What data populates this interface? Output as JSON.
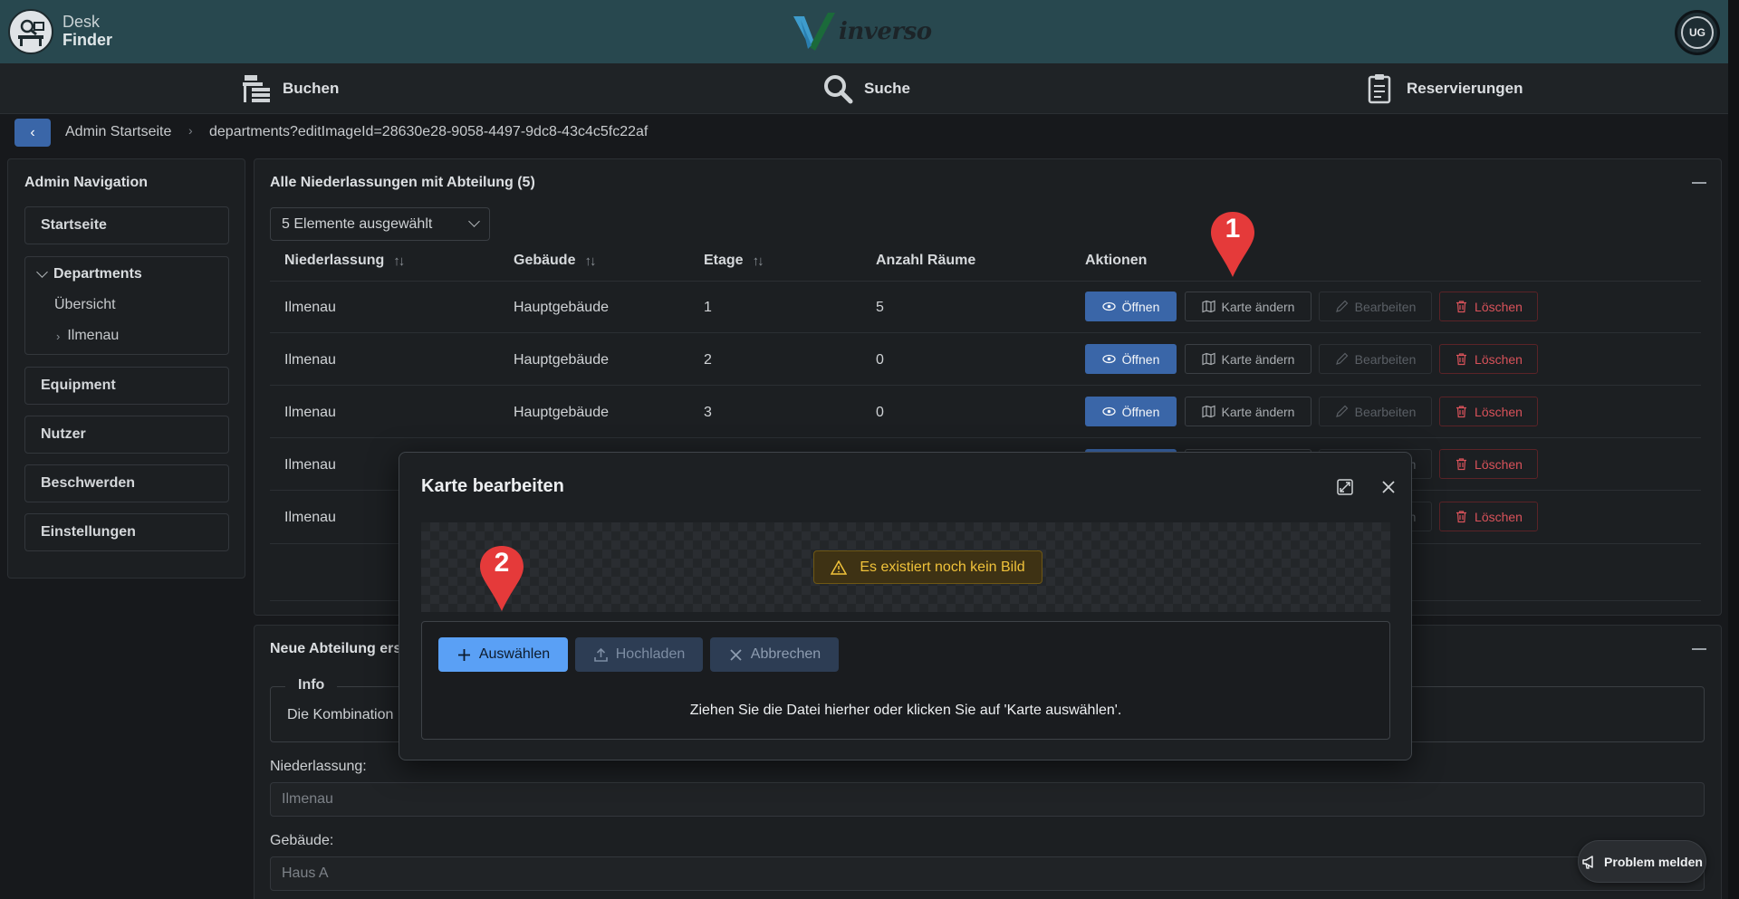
{
  "app": {
    "name_line1": "Desk",
    "name_line2": "Finder",
    "brand": "inverso",
    "user_initials": "UG"
  },
  "nav": {
    "book": "Buchen",
    "search": "Suche",
    "reservations": "Reservierungen"
  },
  "breadcrumb": {
    "home": "Admin Startseite",
    "current": "departments?editImageId=28630e28-9058-4497-9dc8-43c4c5fc22af"
  },
  "sidebar": {
    "title": "Admin Navigation",
    "start": "Startseite",
    "departments": "Departments",
    "overview": "Übersicht",
    "ilmenau": "Ilmenau",
    "equipment": "Equipment",
    "users": "Nutzer",
    "complaints": "Beschwerden",
    "settings": "Einstellungen"
  },
  "table_card": {
    "title": "Alle Niederlassungen mit Abteilung (5)",
    "selection": "5 Elemente ausgewählt",
    "headers": {
      "branch": "Niederlassung",
      "building": "Gebäude",
      "floor": "Etage",
      "rooms": "Anzahl Räume",
      "actions": "Aktionen"
    },
    "rows": [
      {
        "branch": "Ilmenau",
        "building": "Hauptgebäude",
        "floor": "1",
        "rooms": "5"
      },
      {
        "branch": "Ilmenau",
        "building": "Hauptgebäude",
        "floor": "2",
        "rooms": "0"
      },
      {
        "branch": "Ilmenau",
        "building": "Hauptgebäude",
        "floor": "3",
        "rooms": "0"
      },
      {
        "branch": "Ilmenau",
        "building": "",
        "floor": "",
        "rooms": ""
      },
      {
        "branch": "Ilmenau",
        "building": "",
        "floor": "",
        "rooms": ""
      }
    ],
    "actions": {
      "open": "Öffnen",
      "change_map": "Karte ändern",
      "edit": "Bearbeiten",
      "delete": "Löschen"
    }
  },
  "form_card": {
    "title": "Neue Abteilung ers",
    "info_legend": "Info",
    "info_text": "Die Kombination",
    "branch_label": "Niederlassung:",
    "branch_value": "Ilmenau",
    "building_label": "Gebäude:",
    "building_value": "Haus A"
  },
  "modal": {
    "title": "Karte bearbeiten",
    "warning": "Es existiert noch kein Bild",
    "choose": "Auswählen",
    "upload": "Hochladen",
    "cancel": "Abbrechen",
    "hint": "Ziehen Sie die Datei hierher oder klicken Sie auf 'Karte auswählen'."
  },
  "markers": {
    "m1": "1",
    "m2": "2"
  },
  "problem_button": "Problem melden",
  "colors": {
    "header": "#28484f",
    "primary": "#3a66a8",
    "danger": "#d8525a",
    "warning": "#f0c23a",
    "marker": "#e53a3a"
  }
}
